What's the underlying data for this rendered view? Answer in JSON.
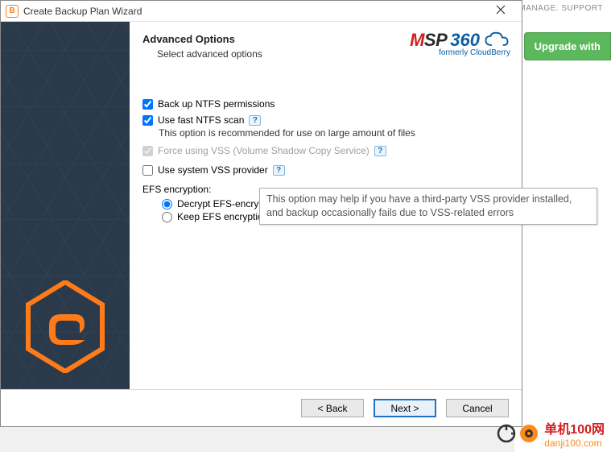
{
  "background": {
    "top_text": "MANAGE. SUPPORT",
    "upgrade_label": "Upgrade with"
  },
  "wizard": {
    "title": "Create Backup Plan Wizard",
    "header": {
      "title": "Advanced Options",
      "subtitle": "Select advanced options"
    },
    "logo": {
      "brand": "MSP360",
      "tagline": "formerly CloudBerry"
    },
    "options": {
      "backup_ntfs_label": "Back up NTFS permissions",
      "backup_ntfs_checked": true,
      "fast_scan_label": "Use fast NTFS scan",
      "fast_scan_checked": true,
      "fast_scan_note": "This option is recommended for use on large amount of files",
      "force_vss_label": "Force using VSS (Volume Shadow Copy Service)",
      "force_vss_checked": true,
      "force_vss_disabled": true,
      "system_vss_label": "Use system VSS provider",
      "system_vss_checked": false,
      "efs_group_label": "EFS encryption:",
      "efs_decrypt_label": "Decrypt EFS-encrypted",
      "efs_keep_label": "Keep EFS encryption",
      "efs_selected": "decrypt"
    },
    "tooltip": "This option may help if you have a third-party VSS provider installed, and backup occasionally fails due to VSS-related errors",
    "buttons": {
      "back": "< Back",
      "next": "Next >",
      "cancel": "Cancel"
    }
  },
  "watermark": {
    "cn": "单机100网",
    "url": "danji100.com"
  }
}
